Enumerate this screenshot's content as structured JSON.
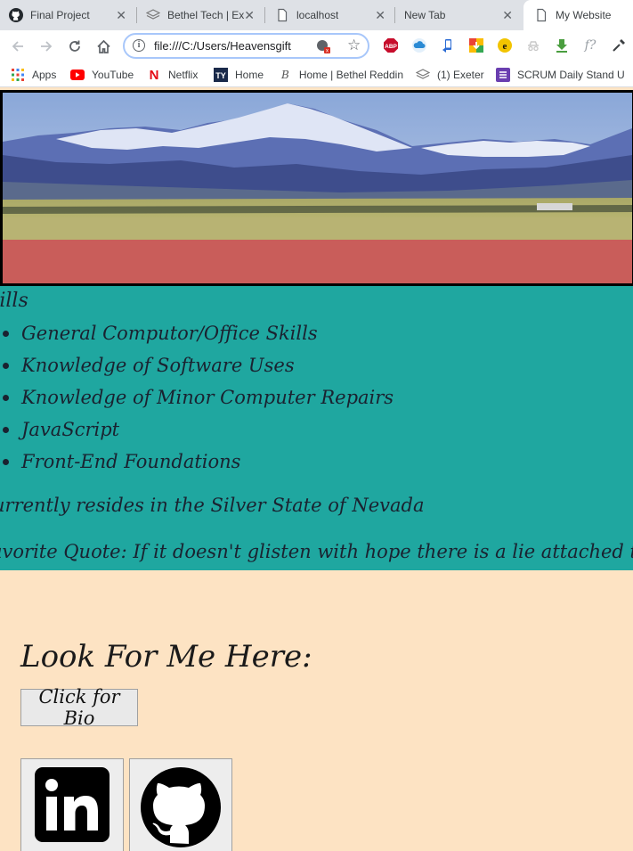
{
  "browser": {
    "tabs": [
      {
        "title": "Final Project",
        "icon": "github-icon"
      },
      {
        "title": "Bethel Tech | Ex",
        "icon": "layers-icon"
      },
      {
        "title": "localhost",
        "icon": "page-icon"
      },
      {
        "title": "New Tab",
        "icon": ""
      },
      {
        "title": "My Website",
        "icon": "page-icon"
      }
    ],
    "active_tab": 4,
    "url": "file:///C:/Users/Heavensgift",
    "bookmarks": [
      {
        "label": "Apps",
        "icon": "apps-grid-icon"
      },
      {
        "label": "YouTube",
        "icon": "youtube-icon"
      },
      {
        "label": "Netflix",
        "icon": "netflix-icon"
      },
      {
        "label": "Home",
        "icon": "tv-icon"
      },
      {
        "label": "Home | Bethel Reddin",
        "icon": "bethel-icon"
      },
      {
        "label": "(1) Exeter",
        "icon": "layers-icon"
      },
      {
        "label": "SCRUM Daily Stand U",
        "icon": "scrum-icon"
      }
    ],
    "extensions": [
      "abp-icon",
      "cloud-icon",
      "phone-icon",
      "drive-icon",
      "e-icon",
      "incognito-icon",
      "download-icon",
      "formula-icon",
      "eyedropper-icon"
    ]
  },
  "page": {
    "skills_heading": "kills",
    "skills": [
      "General Computor/Office Skills",
      "Knowledge of Software Uses",
      "Knowledge of Minor Computer Repairs",
      "JavaScript",
      "Front-End Foundations"
    ],
    "resides": "urrently resides in the Silver State of Nevada",
    "quote": "avorite Quote: If it doesn't glisten with hope there is a lie attached to it! (Frances Fr",
    "look_for": "Look For Me Here:",
    "bio_button": "Click for Bio",
    "social_links": [
      "linkedin-icon",
      "github-icon"
    ]
  },
  "colors": {
    "banner_red": "#c95d5a",
    "teal": "#1fa7a0",
    "peach": "#fde3c3"
  }
}
